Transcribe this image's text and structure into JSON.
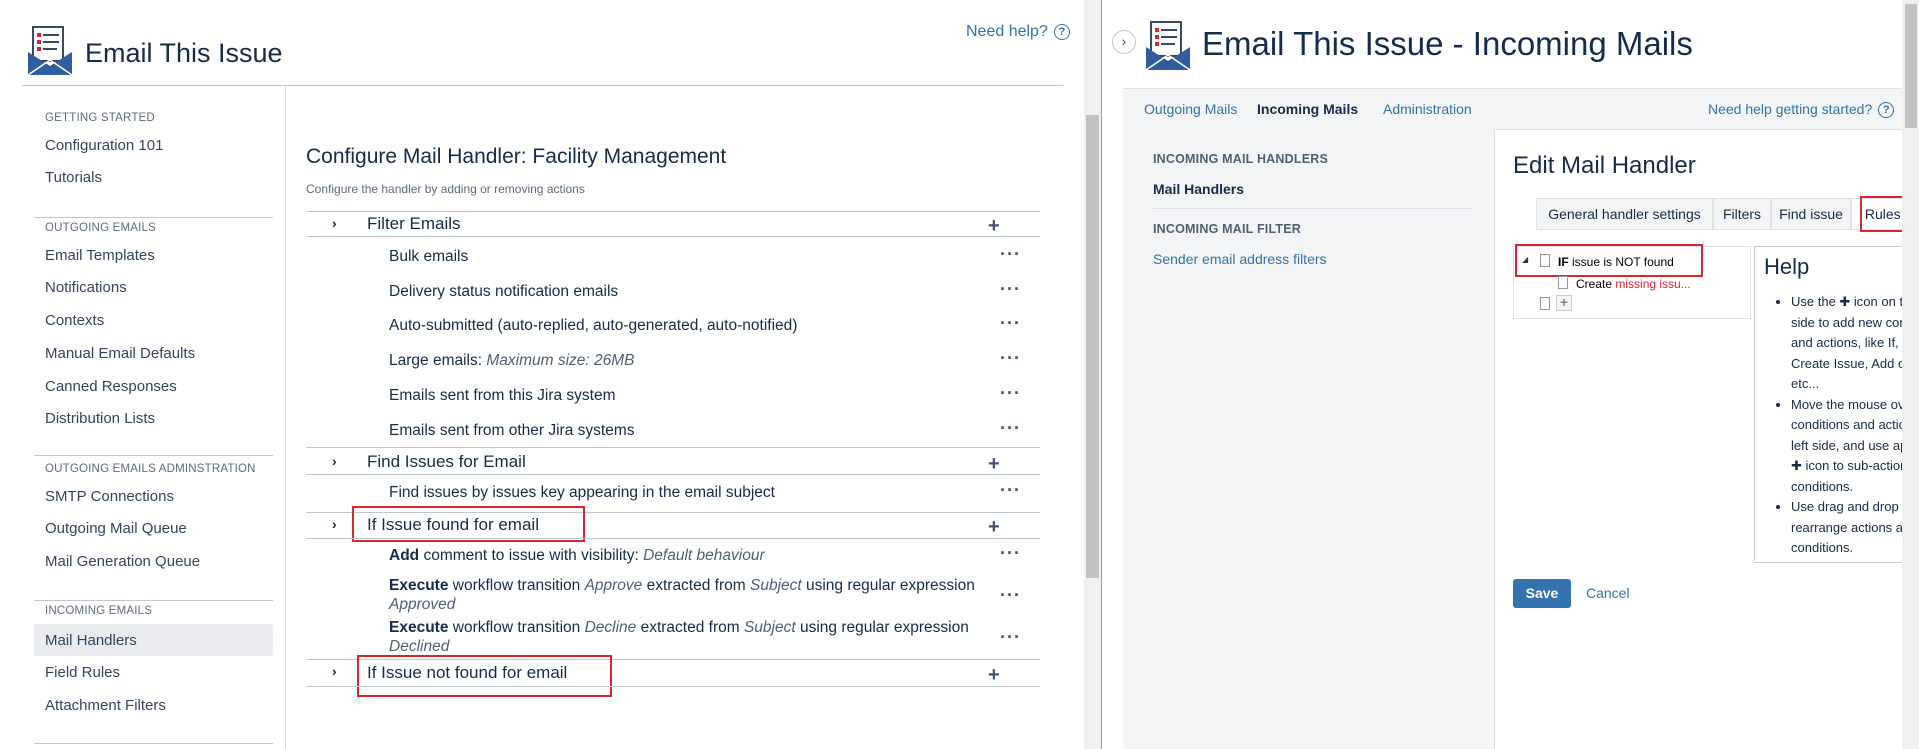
{
  "left": {
    "app_title": "Email This Issue",
    "need_help": "Need help?",
    "sidebar": [
      {
        "heading": "GETTING STARTED",
        "items": [
          "Configuration 101",
          "Tutorials"
        ]
      },
      {
        "heading": "OUTGOING EMAILS",
        "items": [
          "Email Templates",
          "Notifications",
          "Contexts",
          "Manual Email Defaults",
          "Canned Responses",
          "Distribution Lists"
        ]
      },
      {
        "heading": "OUTGOING EMAILS ADMINSTRATION",
        "items": [
          "SMTP Connections",
          "Outgoing Mail Queue",
          "Mail Generation Queue"
        ]
      },
      {
        "heading": "INCOMING EMAILS",
        "items": [
          "Mail Handlers",
          "Field Rules",
          "Attachment Filters"
        ]
      }
    ],
    "active_item": "Mail Handlers",
    "config_title": "Configure Mail Handler: Facility Management",
    "config_subtitle": "Configure the handler by adding or removing actions",
    "groups": [
      {
        "title": "Filter Emails",
        "rows": [
          {
            "text": "Bulk emails"
          },
          {
            "text": "Delivery status notification emails"
          },
          {
            "text": "Auto-submitted (auto-replied, auto-generated, auto-notified)"
          },
          {
            "text": "Large emails:",
            "italic": "Maximum size: 26MB"
          },
          {
            "text": "Emails sent from this Jira system"
          },
          {
            "text": "Emails sent from other Jira systems"
          }
        ]
      },
      {
        "title": "Find Issues for Email",
        "rows": [
          {
            "text": "Find issues by issues key appearing in the email subject"
          }
        ]
      },
      {
        "title": "If Issue found for email",
        "rows": [
          {
            "bold": "Add",
            "text": " comment to issue with visibility: ",
            "italic": "Default behaviour"
          },
          {
            "bold": "Execute",
            "parts": [
              " workflow transition ",
              "Approve",
              " extracted from ",
              "Subject",
              " using regular expression ",
              "Approved"
            ]
          },
          {
            "bold": "Execute",
            "parts": [
              " workflow transition ",
              "Decline",
              " extracted from ",
              "Subject",
              " using regular expression ",
              "Declined"
            ]
          }
        ]
      },
      {
        "title": "If Issue not found for email",
        "rows": []
      }
    ]
  },
  "right": {
    "title": "Email This Issue - Incoming Mails",
    "tabs": [
      "Outgoing Mails",
      "Incoming Mails",
      "Administration"
    ],
    "active_tab": "Incoming Mails",
    "help_started": "Need help getting started?",
    "side_sections": [
      {
        "heading": "INCOMING MAIL HANDLERS",
        "items": [
          "Mail Handlers"
        ]
      },
      {
        "heading": "INCOMING MAIL FILTER",
        "items": [
          "Sender email address filters"
        ]
      }
    ],
    "edit_title": "Edit Mail Handler",
    "edit_tabs": [
      "General handler settings",
      "Filters",
      "Find issue",
      "Rules and actions"
    ],
    "tree": {
      "condition_keyword": "IF",
      "condition_text": " issue is NOT found",
      "action_prefix": "Create ",
      "action_red": "missing issu..."
    },
    "help": {
      "title": "Help",
      "items": [
        "Use the ✚ icon on the left side to add new conditions and actions, like If, Else, Create Issue, Add comment, etc...",
        "Move the mouse over conditions and actions on the left side, and use appearing ✚ icon to sub-actions or conditions.",
        "Use drag and drop to rearrange actions and conditions."
      ]
    },
    "save_label": "Save",
    "cancel_label": "Cancel"
  },
  "colors": {
    "accent": "#3572b0",
    "highlight_box": "#d9272e",
    "missing_text": "#d9272e"
  },
  "icons": [
    "email-issue-logo-icon",
    "help-circle-icon",
    "chevron-right-icon",
    "plus-icon",
    "more-dots-icon",
    "collapse-chevron-icon",
    "tree-toggle-icon",
    "document-icon"
  ]
}
